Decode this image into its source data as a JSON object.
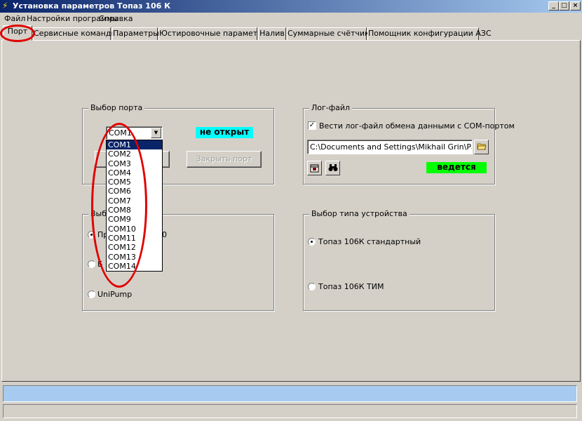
{
  "window": {
    "title": "Установка параметров Топаз 106 К",
    "controls": {
      "minimize": "_",
      "maximize": "□",
      "close": "×"
    }
  },
  "menu": [
    "Файл",
    "Настройки программы",
    "Справка"
  ],
  "tabs": [
    "Порт",
    "Сервисные команды",
    "Параметры",
    "Юстировочные параметры",
    "Налив",
    "Суммарные счётчики",
    "Помощник конфигурации АЗС"
  ],
  "port_group": {
    "title": "Выбор порта",
    "selected": "COM1",
    "status": "не открыт",
    "close_button": "Закрыть порт",
    "options": [
      "COM1",
      "COM2",
      "COM3",
      "COM4",
      "COM5",
      "COM6",
      "COM7",
      "COM8",
      "COM9",
      "COM10",
      "COM11",
      "COM12",
      "COM13",
      "COM14"
    ]
  },
  "protocol_group": {
    "title_visible": "Выбо",
    "radio1_visible": "Пр",
    "radio1_tail": "0",
    "radio2_visible": "Б",
    "radio3": "UniPump"
  },
  "log_group": {
    "title": "Лог-файл",
    "checkbox_label": "Вести лог-файл обмена данными с COM-портом",
    "checked": true,
    "path": "C:\\Documents and Settings\\Mikhail Grin\\Рабочи",
    "status": "ведется"
  },
  "device_group": {
    "title": "Выбор типа устройства",
    "option1": "Топаз 106К стандартный",
    "option2": "Топаз 106К ТИМ"
  },
  "colors": {
    "port_status_bg": "#00ffff",
    "log_status_bg": "#00ff00",
    "title_gradient_start": "#0a246a",
    "annotation": "#e00000"
  },
  "icons": {
    "folder": "folder-open-icon",
    "view": "view-file-icon",
    "binoculars": "binoculars-icon"
  }
}
